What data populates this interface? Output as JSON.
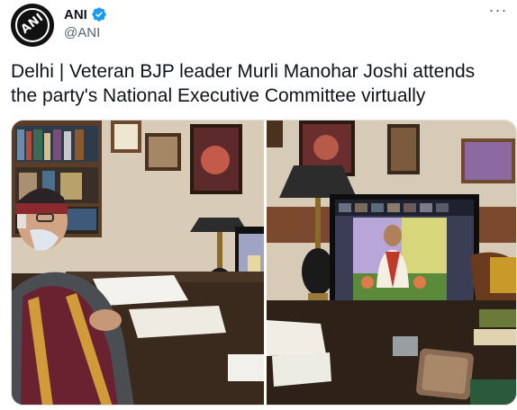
{
  "tweet": {
    "author": {
      "display_name": "ANI",
      "handle": "@ANI",
      "avatar_text": "ANI",
      "verified": true
    },
    "text_lines": [
      "Delhi | Veteran BJP leader Murli Manohar Joshi attends",
      "the party's National Executive Committee virtually"
    ],
    "media": [
      {
        "icon": "photo-icon",
        "description_visible": false
      },
      {
        "icon": "photo-icon",
        "description_visible": false
      }
    ]
  },
  "colors": {
    "verified_blue": "#1d9bf0",
    "text_primary": "#0f1419",
    "text_secondary": "#536471"
  },
  "icons": {
    "verified": "verified-badge-icon",
    "more": "more-options-icon"
  }
}
